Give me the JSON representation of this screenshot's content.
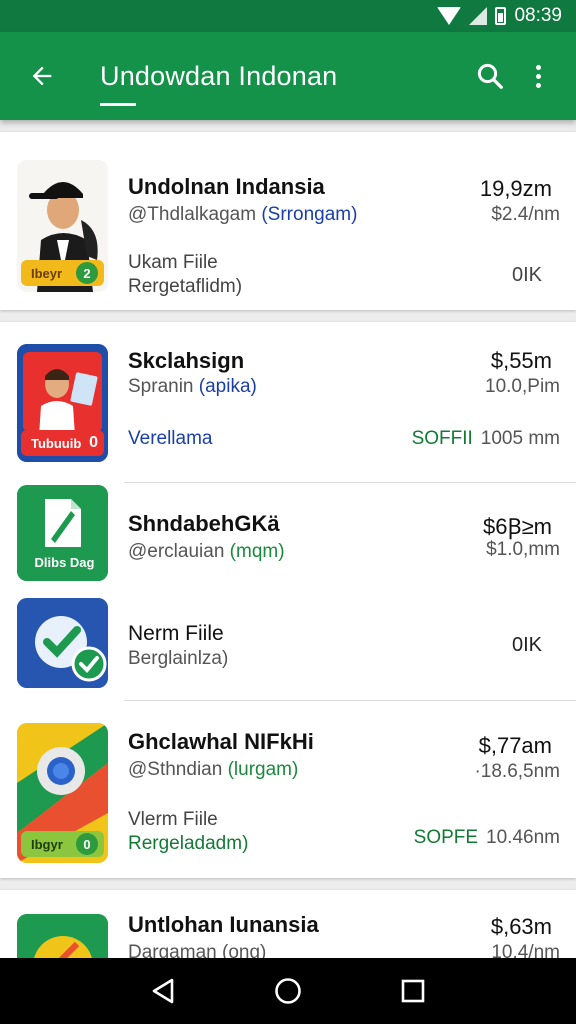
{
  "status_bar": {
    "time": "08:39"
  },
  "app_bar": {
    "title": "Undowdan Indonan"
  },
  "items": [
    {
      "name": "Undolnan Indansia",
      "sub_prefix": "@Thdlalkagam ",
      "sub_highlight": "(Srrongam)",
      "line3": "Ukam Fiile",
      "line4": "Rergetaflidm)",
      "price": "19,9zm",
      "price2": "$2.4/nm",
      "size": "0IK",
      "badge_text": "Ibeyr",
      "badge_num": "2"
    },
    {
      "name": "Skclahsign",
      "sub_prefix": "Spranin ",
      "sub_highlight": "(apika)",
      "line3": "Verellama",
      "price": "$,55m",
      "price2": "10.0,Pim",
      "status_label": "SOFFII",
      "size": "1005 mm",
      "badge_text": "Tubuuib",
      "badge_num": "0"
    },
    {
      "name": "ShndabehGKä",
      "sub_prefix": "@erclauian ",
      "sub_highlight": "(mqm)",
      "price": "$6Ꞵ≥m",
      "price2": "$1.0,mm",
      "badge_text": "Dlibs Dag"
    },
    {
      "name": "Nerm Fiile",
      "sub_prefix": "Berglainlza)",
      "sub_highlight": "",
      "size": "0IK"
    },
    {
      "name": "Ghclawhal NIFkHi",
      "sub_prefix": "@Sthndian ",
      "sub_highlight": "(lurgam)",
      "line3": "Vlerm Fiile",
      "line4": "Rergeladadm)",
      "price": "$,77am",
      "price2": "·18.6,5nm",
      "status_label": "SOPFE",
      "size": "10.46nm",
      "badge_text": "Ibgyr",
      "badge_num": "0"
    },
    {
      "name": "Untlohan Iunansia",
      "sub_prefix": "Dargaman (ong)",
      "sub_highlight": "",
      "price": "$,63m",
      "price2": "10.4/nm"
    }
  ],
  "colors": {
    "primary": "#14924a",
    "status": "#10793f",
    "link_blue": "#1a3fa8",
    "green_text": "#137a35"
  },
  "icons": [
    "back-arrow-icon",
    "search-icon",
    "more-vert-icon",
    "wifi-icon",
    "signal-icon",
    "battery-icon",
    "nav-back-icon",
    "nav-home-icon",
    "nav-recents-icon"
  ]
}
